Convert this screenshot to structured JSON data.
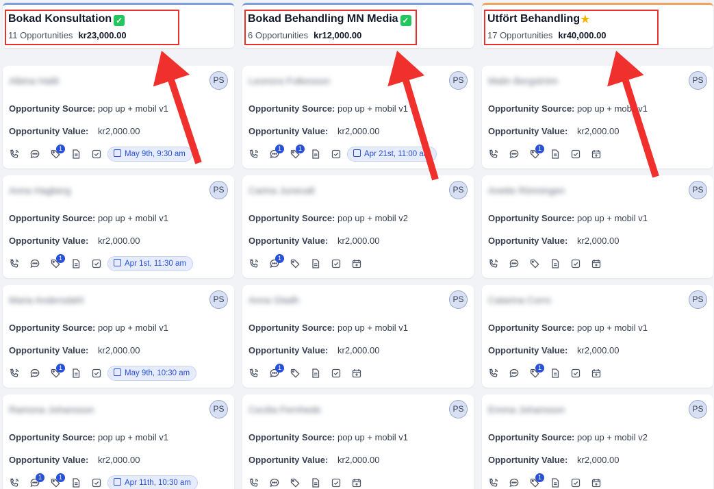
{
  "columns": [
    {
      "title": "Bokad Konsultation",
      "title_emoji": "✓",
      "count": "11 Opportunities",
      "amount": "kr23,000.00",
      "cards": [
        {
          "name": "Albina Halili",
          "avatar": "PS",
          "source_label": "Opportunity Source:",
          "source": "pop up + mobil v1",
          "value_label": "Opportunity Value:",
          "value": "kr2,000.00",
          "chat_badge": "",
          "tag_badge": "1",
          "appointment": "May 9th, 9:30 am"
        },
        {
          "name": "Anna Hagberg",
          "avatar": "PS",
          "source_label": "Opportunity Source:",
          "source": "pop up + mobil v1",
          "value_label": "Opportunity Value:",
          "value": "kr2,000.00",
          "chat_badge": "",
          "tag_badge": "1",
          "appointment": "Apr 1st, 11:30 am"
        },
        {
          "name": "Maria Andersdahl",
          "avatar": "PS",
          "source_label": "Opportunity Source:",
          "source": "pop up + mobil v1",
          "value_label": "Opportunity Value:",
          "value": "kr2,000.00",
          "chat_badge": "",
          "tag_badge": "1",
          "appointment": "May 9th, 10:30 am"
        },
        {
          "name": "Ramona Johansson",
          "avatar": "PS",
          "source_label": "Opportunity Source:",
          "source": "pop up + mobil v1",
          "value_label": "Opportunity Value:",
          "value": "kr2,000.00",
          "chat_badge": "1",
          "tag_badge": "1",
          "appointment": "Apr 11th, 10:30 am"
        }
      ]
    },
    {
      "title": "Bokad Behandling MN Media",
      "title_emoji": "✓",
      "count": "6 Opportunities",
      "amount": "kr12,000.00",
      "cards": [
        {
          "name": "Leonora Folkesson",
          "avatar": "PS",
          "source_label": "Opportunity Source:",
          "source": "pop up + mobil v1",
          "value_label": "Opportunity Value:",
          "value": "kr2,000.00",
          "chat_badge": "1",
          "tag_badge": "1",
          "appointment": "Apr 21st, 11:00 am"
        },
        {
          "name": "Carina Junevall",
          "avatar": "PS",
          "source_label": "Opportunity Source:",
          "source": "pop up + mobil v2",
          "value_label": "Opportunity Value:",
          "value": "kr2,000.00",
          "chat_badge": "1",
          "tag_badge": "",
          "appointment": ""
        },
        {
          "name": "Anna Gladh",
          "avatar": "PS",
          "source_label": "Opportunity Source:",
          "source": "pop up + mobil v1",
          "value_label": "Opportunity Value:",
          "value": "kr2,000.00",
          "chat_badge": "1",
          "tag_badge": "",
          "appointment": ""
        },
        {
          "name": "Cecilia Fernhede",
          "avatar": "PS",
          "source_label": "Opportunity Source:",
          "source": "pop up + mobil v1",
          "value_label": "Opportunity Value:",
          "value": "kr2,000.00",
          "chat_badge": "",
          "tag_badge": "",
          "appointment": ""
        }
      ]
    },
    {
      "title": "Utfört Behandling",
      "title_emoji": "★",
      "count": "17 Opportunities",
      "amount": "kr40,000.00",
      "cards": [
        {
          "name": "Malin Bergström",
          "avatar": "PS",
          "source_label": "Opportunity Source:",
          "source": "pop up + mobil v1",
          "value_label": "Opportunity Value:",
          "value": "kr2,000.00",
          "chat_badge": "",
          "tag_badge": "1",
          "appointment": ""
        },
        {
          "name": "Anette Rönningen",
          "avatar": "PS",
          "source_label": "Opportunity Source:",
          "source": "pop up + mobil v1",
          "value_label": "Opportunity Value:",
          "value": "kr2,000.00",
          "chat_badge": "",
          "tag_badge": "",
          "appointment": ""
        },
        {
          "name": "Catarina Corro",
          "avatar": "PS",
          "source_label": "Opportunity Source:",
          "source": "pop up + mobil v1",
          "value_label": "Opportunity Value:",
          "value": "kr2,000.00",
          "chat_badge": "",
          "tag_badge": "1",
          "appointment": ""
        },
        {
          "name": "Emma Johansson",
          "avatar": "PS",
          "source_label": "Opportunity Source:",
          "source": "pop up + mobil v2",
          "value_label": "Opportunity Value:",
          "value": "kr2,000.00",
          "chat_badge": "",
          "tag_badge": "1",
          "appointment": ""
        }
      ]
    }
  ],
  "colors": {
    "highlight_box": "#e8302f",
    "arrow": "#f0302c",
    "badge": "#2851d6",
    "appointment_bg": "#e6ecfb"
  },
  "icons": [
    "phone-icon",
    "chat-icon",
    "tag-icon",
    "document-icon",
    "checkbox-icon",
    "calendar-add-icon"
  ]
}
